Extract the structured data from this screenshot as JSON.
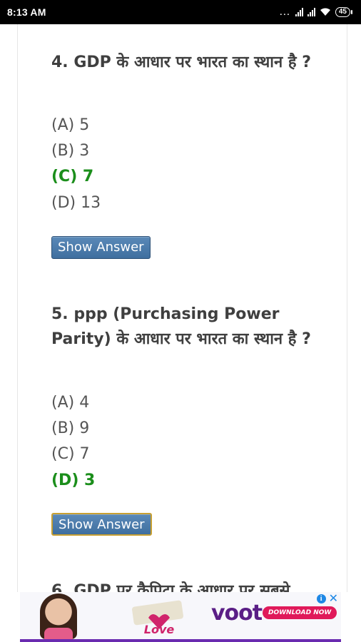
{
  "status_bar": {
    "time": "8:13 AM",
    "battery": "45"
  },
  "questions": [
    {
      "title": "4. GDP के आधार पर भारत का स्थान है ?",
      "options": [
        {
          "text": "(A) 5",
          "correct": false
        },
        {
          "text": "(B) 3",
          "correct": false
        },
        {
          "text": "(C) 7",
          "correct": true
        },
        {
          "text": "(D) 13",
          "correct": false
        }
      ],
      "button": "Show Answer"
    },
    {
      "title": "5. ppp (Purchasing Power Parity) के आधार पर भारत का स्थान है ?",
      "options": [
        {
          "text": "(A) 4",
          "correct": false
        },
        {
          "text": "(B) 9",
          "correct": false
        },
        {
          "text": "(C) 7",
          "correct": false
        },
        {
          "text": "(D) 3",
          "correct": true
        }
      ],
      "button": "Show Answer"
    },
    {
      "title_partial": "6. GDP पर कैपिटा के आधार पर सबसे"
    }
  ],
  "ad": {
    "brand": "voot",
    "cta": "DOWNLOAD NOW",
    "info_icon": "info-icon",
    "close_icon": "close-icon",
    "accent": "#5a1e86"
  }
}
